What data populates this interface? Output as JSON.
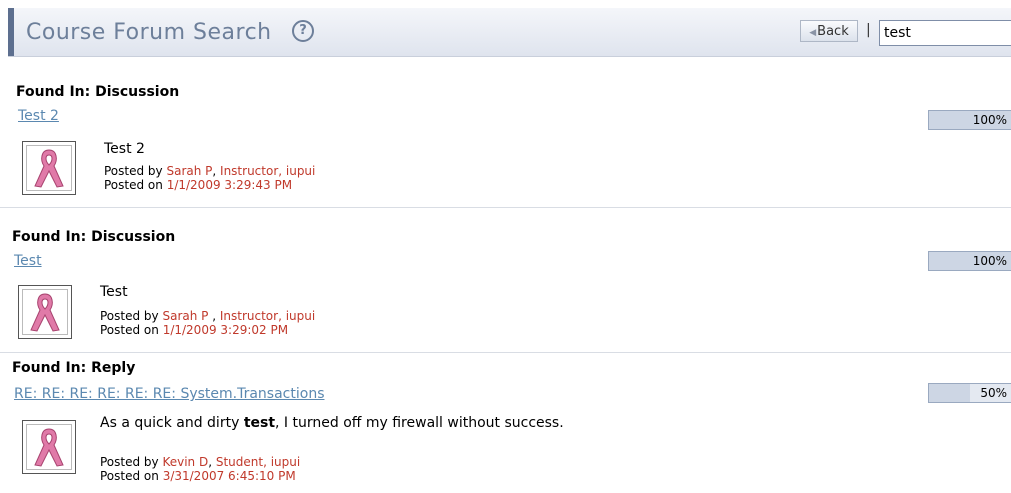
{
  "header": {
    "title": "Course Forum Search",
    "help_icon": "question-circle-icon",
    "back_label": "Back",
    "separator": "|",
    "search_value": "test"
  },
  "results": [
    {
      "found_label": "Found In: Discussion",
      "link": "Test 2",
      "score": "100%",
      "score_fraction": 1.0,
      "title_plain": "Test 2",
      "title_bold": "",
      "title_after": "",
      "posted_by_prefix": "Posted by ",
      "author": "Sarah P",
      "comma": ", ",
      "role": "Instructor, iupui",
      "posted_on_prefix": "Posted on ",
      "date": "1/1/2009 3:29:43 PM"
    },
    {
      "found_label": "Found In: Discussion",
      "link": "Test",
      "score": "100%",
      "score_fraction": 1.0,
      "title_plain": "Test",
      "title_bold": "",
      "title_after": "",
      "posted_by_prefix": "Posted by ",
      "author": "Sarah P",
      "comma": " , ",
      "role": "Instructor, iupui",
      "posted_on_prefix": "Posted on ",
      "date": "1/1/2009 3:29:02 PM"
    },
    {
      "found_label": "Found In: Reply",
      "link": "RE: RE: RE: RE: RE: RE: System.Transactions",
      "score": "50%",
      "score_fraction": 0.5,
      "title_plain": "As a quick and dirty ",
      "title_bold": "test",
      "title_after": ", I turned off my firewall without success.",
      "posted_by_prefix": "Posted by ",
      "author": "Kevin D",
      "comma": ", ",
      "role": "Student, iupui",
      "posted_on_prefix": "Posted on ",
      "date": "3/31/2007 6:45:10 PM"
    }
  ],
  "avatar_icon": "pink-ribbon-icon",
  "colors": {
    "link": "#5b88b0",
    "meta_red": "#c0392b",
    "ribbon": "#e07aa8"
  }
}
